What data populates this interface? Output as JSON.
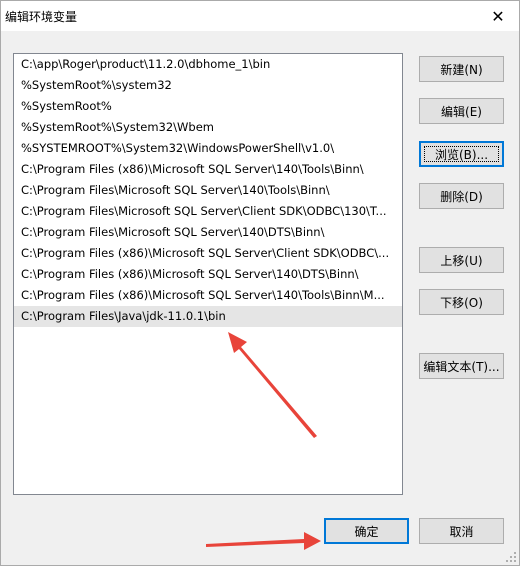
{
  "window": {
    "title": "编辑环境变量",
    "close_glyph": "✕"
  },
  "path_list": {
    "items": [
      "C:\\app\\Roger\\product\\11.2.0\\dbhome_1\\bin",
      "%SystemRoot%\\system32",
      "%SystemRoot%",
      "%SystemRoot%\\System32\\Wbem",
      "%SYSTEMROOT%\\System32\\WindowsPowerShell\\v1.0\\",
      "C:\\Program Files (x86)\\Microsoft SQL Server\\140\\Tools\\Binn\\",
      "C:\\Program Files\\Microsoft SQL Server\\140\\Tools\\Binn\\",
      "C:\\Program Files\\Microsoft SQL Server\\Client SDK\\ODBC\\130\\T...",
      "C:\\Program Files\\Microsoft SQL Server\\140\\DTS\\Binn\\",
      "C:\\Program Files (x86)\\Microsoft SQL Server\\Client SDK\\ODBC\\...",
      "C:\\Program Files (x86)\\Microsoft SQL Server\\140\\DTS\\Binn\\",
      "C:\\Program Files (x86)\\Microsoft SQL Server\\140\\Tools\\Binn\\M...",
      "C:\\Program Files\\Java\\jdk-11.0.1\\bin"
    ],
    "selected_index": 12
  },
  "buttons": {
    "new_label": "新建(N)",
    "edit_label": "编辑(E)",
    "browse_label": "浏览(B)...",
    "delete_label": "删除(D)",
    "move_up_label": "上移(U)",
    "move_down_label": "下移(O)",
    "edit_text_label": "编辑文本(T)...",
    "ok_label": "确定",
    "cancel_label": "取消"
  },
  "colors": {
    "arrow": "#e8443a",
    "focus": "#0078d7"
  }
}
